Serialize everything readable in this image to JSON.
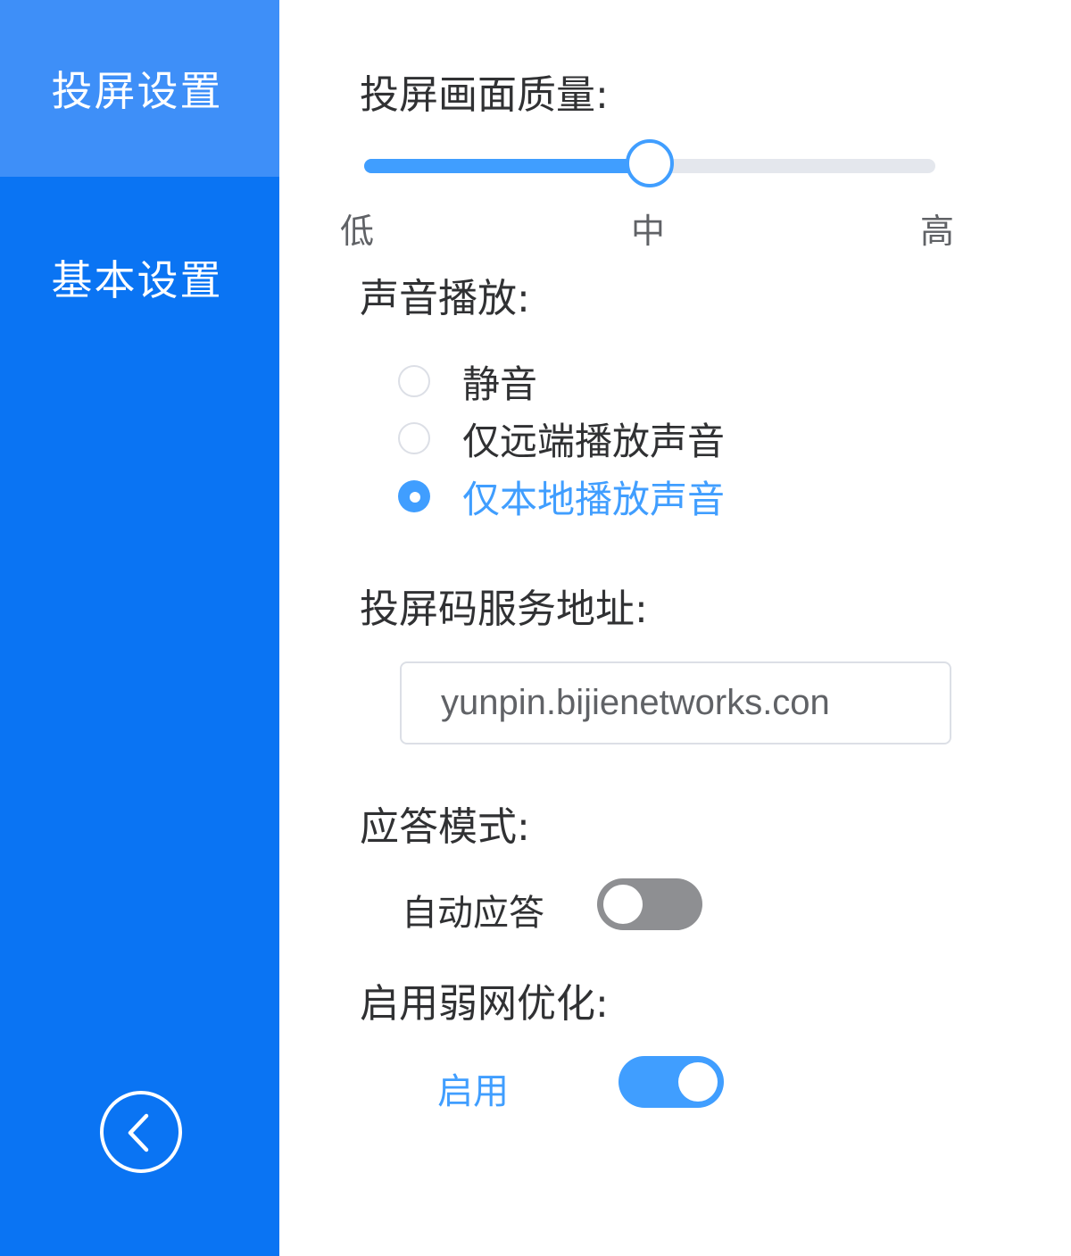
{
  "sidebar": {
    "items": [
      {
        "label": "投屏设置",
        "active": true
      },
      {
        "label": "基本设置",
        "active": false
      }
    ],
    "back_icon": "chevron-left-circle-icon"
  },
  "quality": {
    "label": "投屏画面质量:",
    "ticks": [
      "低",
      "中",
      "高"
    ],
    "value_fraction": 0.5
  },
  "sound": {
    "label": "声音播放:",
    "options": [
      {
        "label": "静音",
        "checked": false
      },
      {
        "label": "仅远端播放声音",
        "checked": false
      },
      {
        "label": "仅本地播放声音",
        "checked": true
      }
    ]
  },
  "server": {
    "label": "投屏码服务地址:",
    "value": "yunpin.bijienetworks.con"
  },
  "answer": {
    "label": "应答模式:",
    "switch_label": "自动应答",
    "enabled": false
  },
  "weaknet": {
    "label": "启用弱网优化:",
    "switch_label": "启用",
    "enabled": true
  },
  "colors": {
    "sidebar_bg": "#0a74f3",
    "sidebar_active_bg": "#3e8ff8",
    "accent": "#409eff",
    "switch_off": "#8e8f92",
    "track": "#e4e7ed"
  }
}
